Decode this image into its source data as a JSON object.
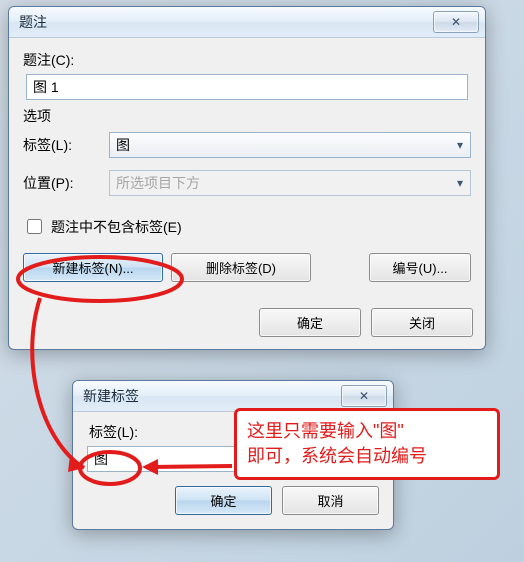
{
  "main": {
    "title": "题注",
    "caption_label": "题注(C):",
    "caption_value": "图 1",
    "options_title": "选项",
    "label_row_label": "标签(L):",
    "label_select_value": "图",
    "position_row_label": "位置(P):",
    "position_select_value": "所选项目下方",
    "exclude_checkbox_label": "题注中不包含标签(E)",
    "new_label_btn": "新建标签(N)...",
    "delete_label_btn": "删除标签(D)",
    "numbering_btn": "编号(U)...",
    "ok_btn": "确定",
    "close_btn": "关闭"
  },
  "newlabel": {
    "title": "新建标签",
    "label_label": "标签(L):",
    "label_value": "图",
    "ok_btn": "确定",
    "cancel_btn": "取消"
  },
  "annotation": {
    "line1": "这里只需要输入\"图\"",
    "line2": "即可，系统会自动编号"
  },
  "icons": {
    "close_glyph": "✕"
  }
}
